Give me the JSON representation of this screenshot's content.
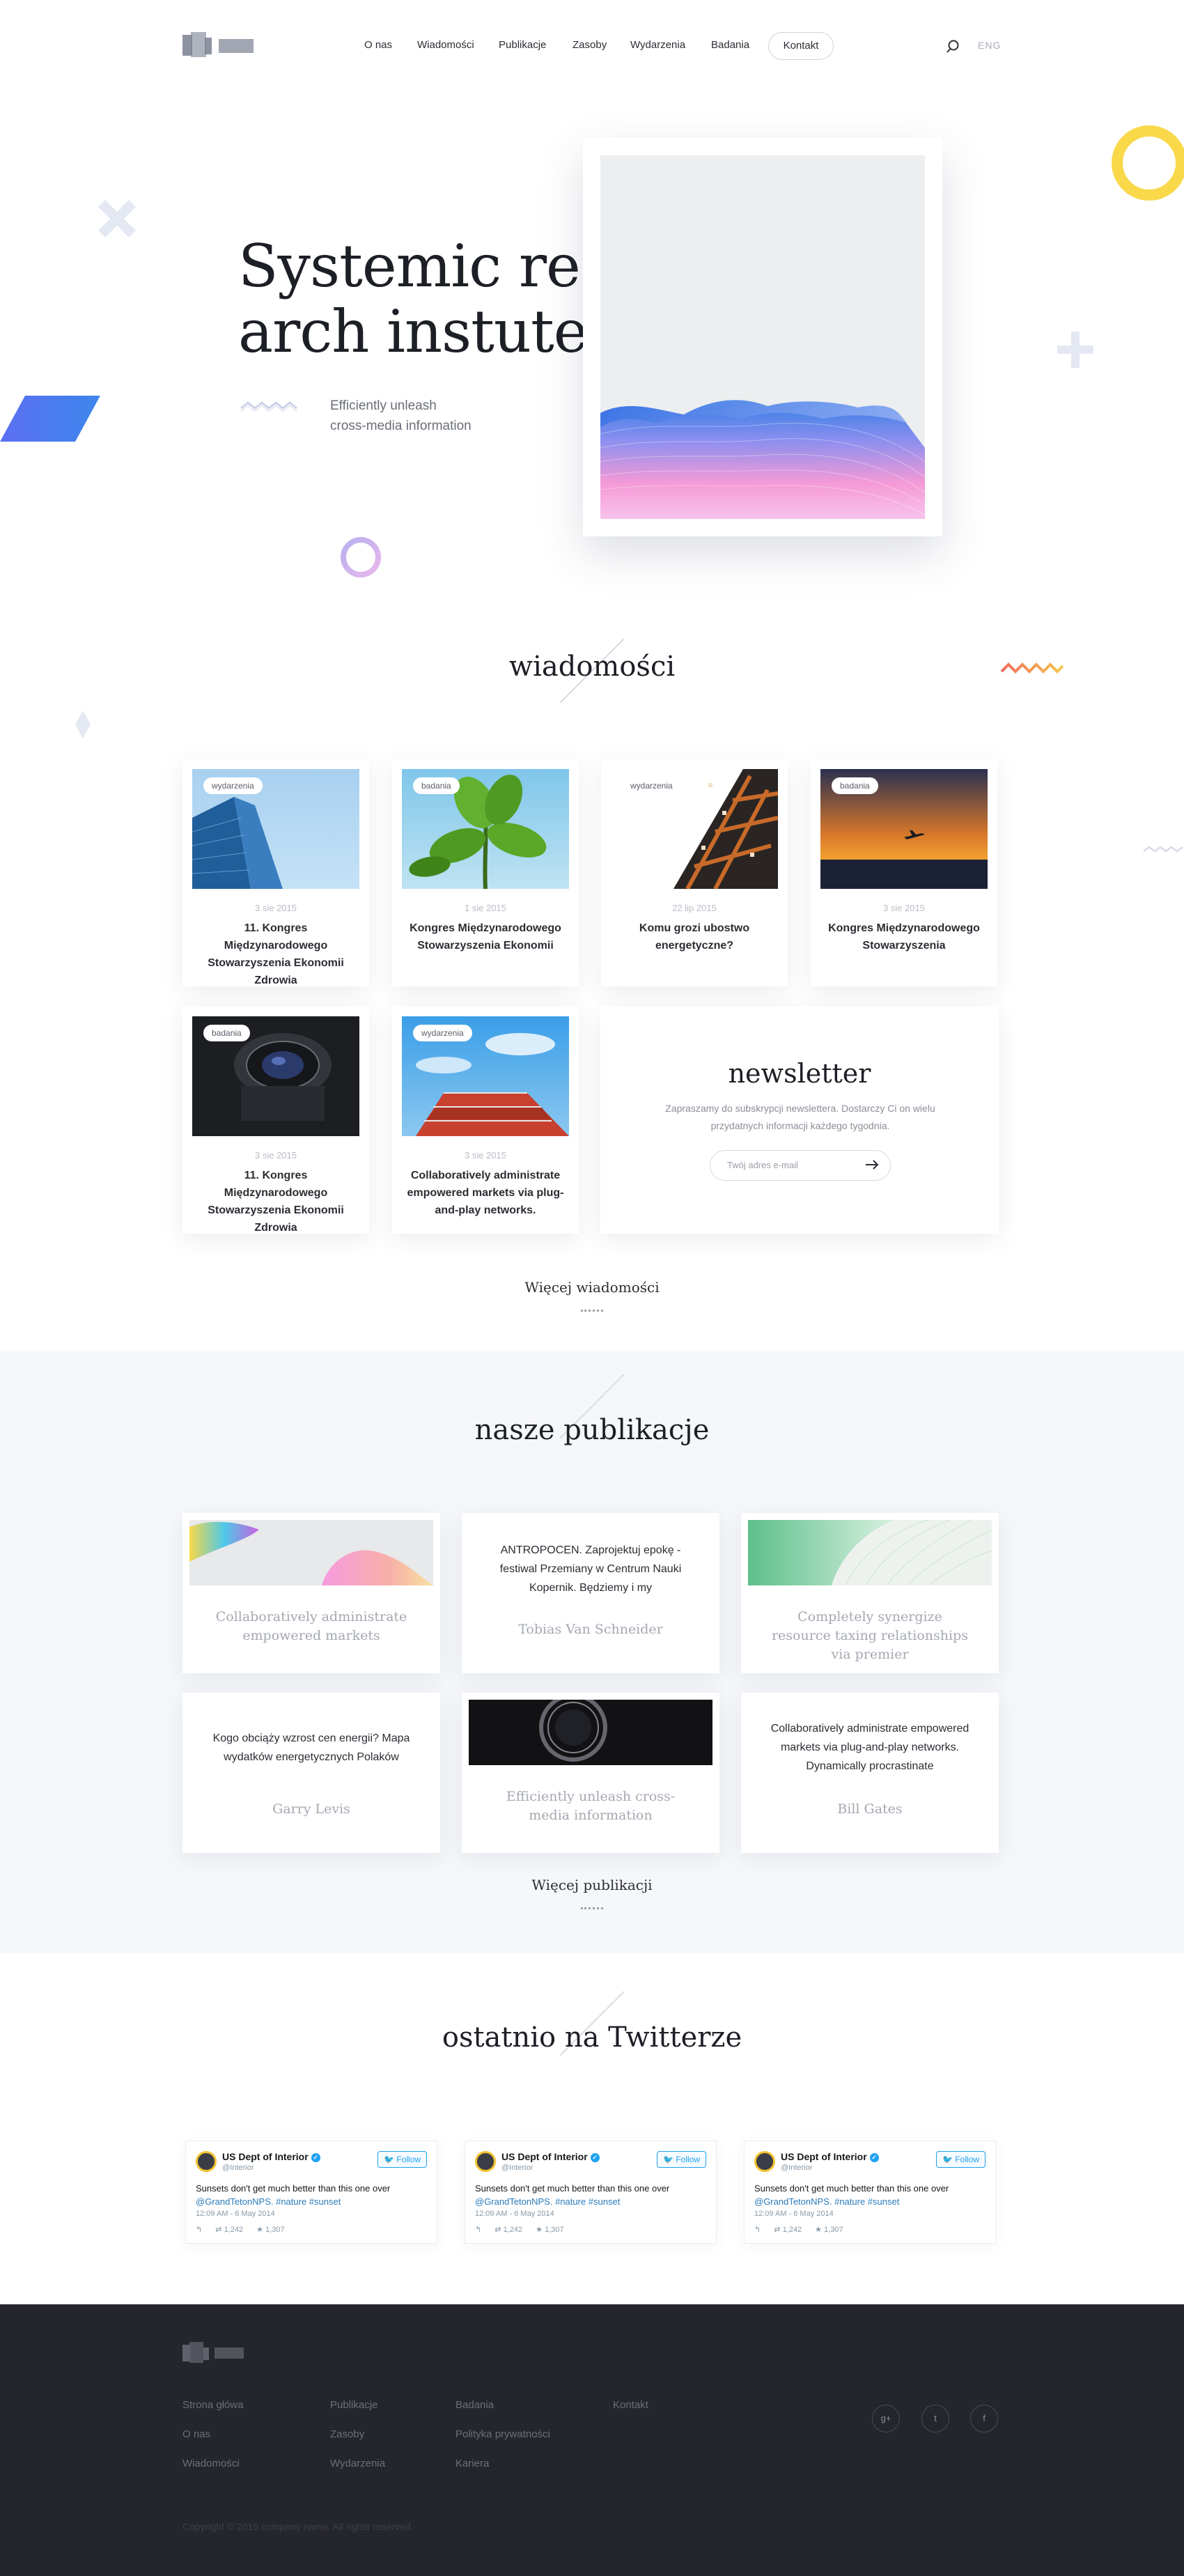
{
  "nav": {
    "items": [
      "O nas",
      "Wiadomości",
      "Publikacje",
      "Zasoby",
      "Wydarzenia",
      "Badania"
    ],
    "contact": "Kontakt",
    "lang": "ENG",
    "search_icon": "search-icon"
  },
  "hero": {
    "title_line1": "Systemic rese-",
    "title_line2": "arch instute",
    "subtitle_line1": "Efficiently unleash",
    "subtitle_line2": "cross-media information"
  },
  "news": {
    "title": "wiadomości",
    "cards": [
      {
        "badge": "wydarzenia",
        "date": "3 sie 2015",
        "title": "11. Kongres Międzynarodowego Stowarzyszenia Ekonomii Zdrowia"
      },
      {
        "badge": "badania",
        "date": "1 sie 2015",
        "title": "Kongres Międzynarodowego Stowarzyszenia Ekonomii"
      },
      {
        "badge": "wydarzenia",
        "date": "22 lip 2015",
        "title": "Komu grozi ubostwo energetyczne?"
      },
      {
        "badge": "badania",
        "date": "3 sie 2015",
        "title": "Kongres Międzynarodowego Stowarzyszenia"
      },
      {
        "badge": "badania",
        "date": "3 sie 2015",
        "title": "11. Kongres Międzynarodowego Stowarzyszenia Ekonomii Zdrowia"
      },
      {
        "badge": "wydarzenia",
        "date": "3 sie 2015",
        "title": "Collaboratively administrate empowered markets via plug-and-play networks."
      }
    ],
    "more": "Więcej wiadomości"
  },
  "newsletter": {
    "title": "newsletter",
    "text": "Zapraszamy do subskrypcji newslettera. Dostarczy Ci on wielu przydatnych informacji każdego tygodnia.",
    "placeholder": "Twój adres e-mail"
  },
  "publications": {
    "title": "nasze publikacje",
    "items": [
      {
        "text": "Collaboratively administrate empowered markets"
      },
      {
        "text": "ANTROPOCEN. Zaprojektuj epokę - festiwal Przemiany w Centrum Nauki Kopernik. Będziemy i my",
        "author": "Tobias Van Schneider"
      },
      {
        "text": "Completely synergize resource taxing relationships via premier"
      },
      {
        "text": "Kogo obciąży wzrost cen energii? Mapa wydatków energetycznych Polaków",
        "author": "Garry Levis"
      },
      {
        "text": "Efficiently unleash cross-media information"
      },
      {
        "text": "Collaboratively administrate empowered markets via plug-and-play networks. Dynamically procrastinate",
        "author": "Bill Gates"
      }
    ],
    "more": "Więcej publikacji"
  },
  "twitter": {
    "title": "ostatnio na Twitterze",
    "tweet": {
      "name": "US Dept of Interior",
      "handle": "@Interior",
      "follow": "Follow",
      "text": "Sunsets don't get much better than this one over",
      "links": "@GrandTetonNPS. #nature #sunset",
      "time": "12:09 AM - 6 May 2014",
      "retweets": "1,242",
      "favorites": "1,307"
    }
  },
  "footer": {
    "col1": [
      "Strona główa",
      "O nas",
      "Wiadomości"
    ],
    "col2": [
      "Publikacje",
      "Zasoby",
      "Wydarzenia"
    ],
    "col3": [
      "Badania",
      "Polityka prywatności",
      "Kariera"
    ],
    "col4": [
      "Kontakt"
    ],
    "social": [
      "g+",
      "t",
      "f"
    ],
    "copyright": "Copyright © 2015 company name. All rights reserved."
  },
  "colors": {
    "accent_blue": "#4f6ef0",
    "accent_yellow": "#f9d84a",
    "footer_bg": "#25262b",
    "pub_bg": "#f5f7fa"
  }
}
